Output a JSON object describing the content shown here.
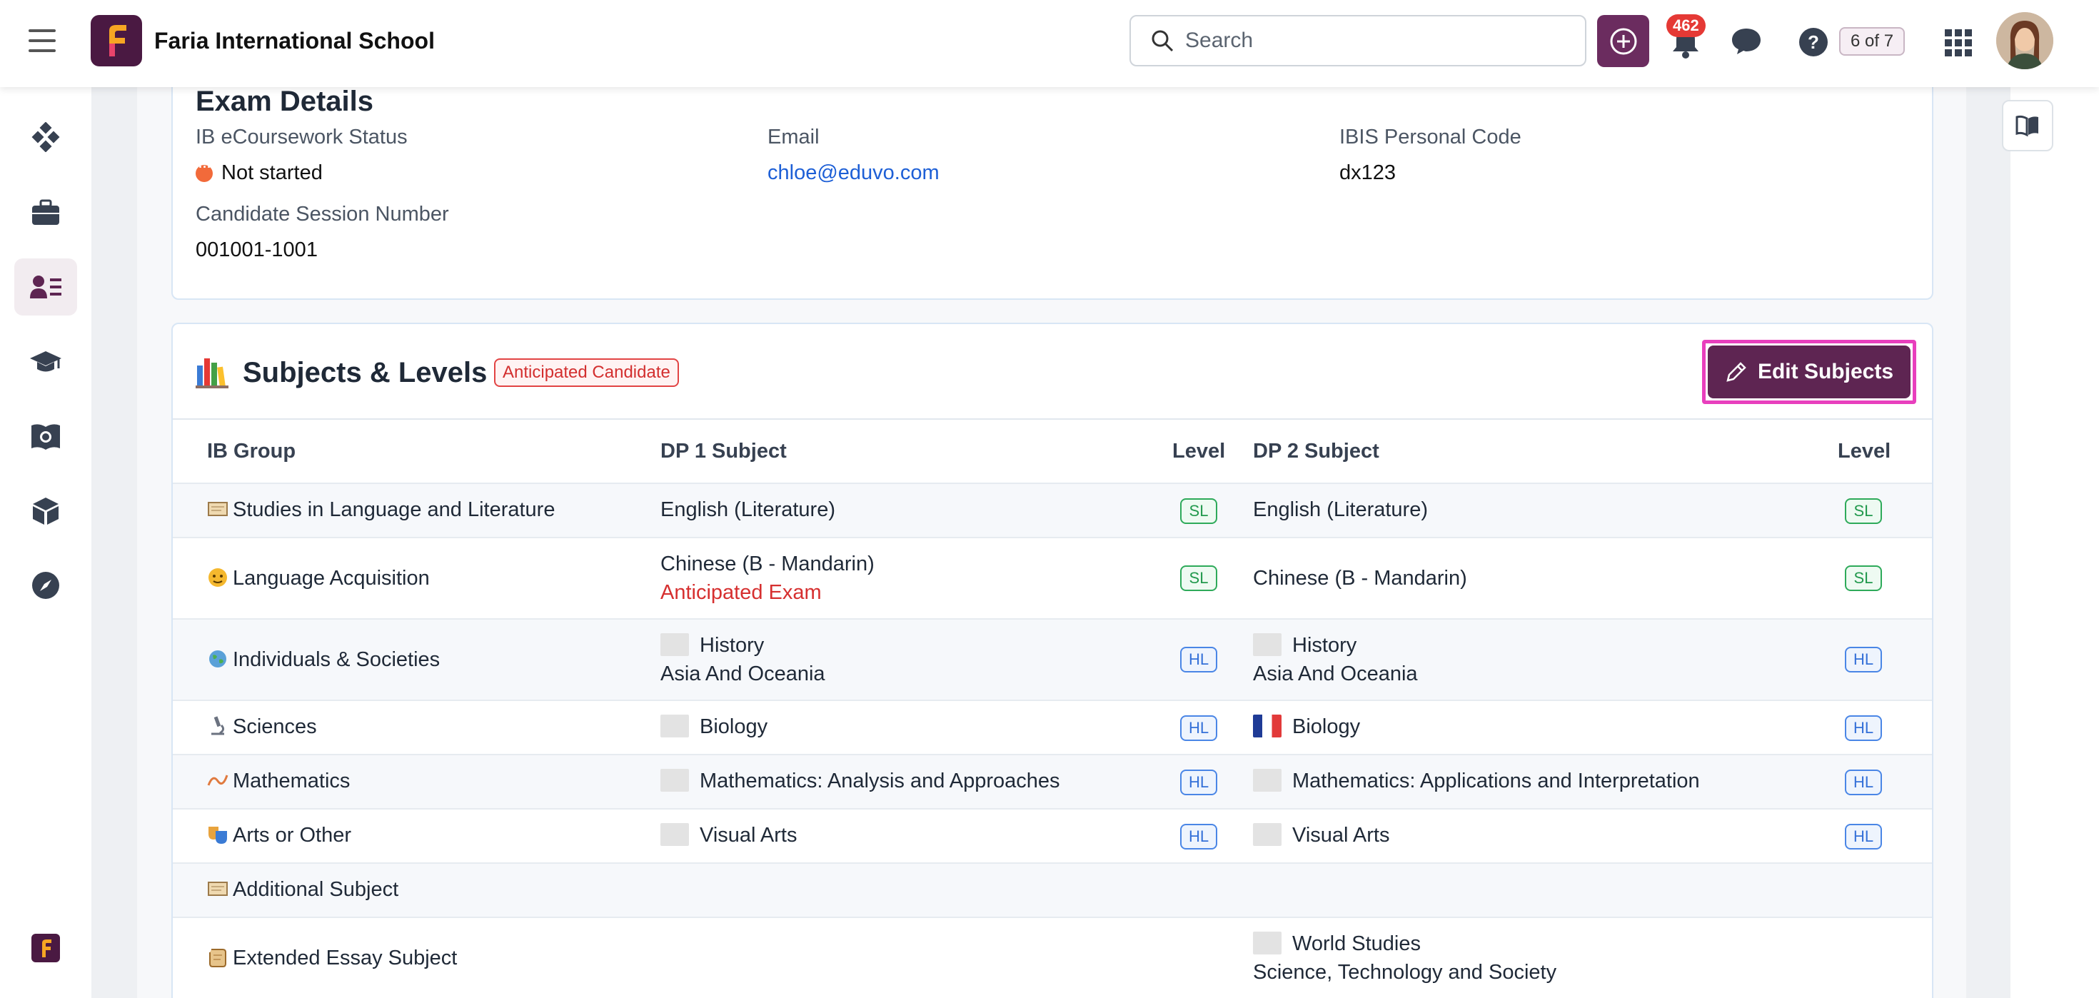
{
  "header": {
    "school_name": "Faria International School",
    "search_placeholder": "Search",
    "notification_count": "462",
    "progress": "6 of 7"
  },
  "sidebar": {
    "items": [
      {
        "name": "dashboard",
        "icon": "diamond-grid-icon"
      },
      {
        "name": "briefcase",
        "icon": "briefcase-icon"
      },
      {
        "name": "students",
        "icon": "student-list-icon",
        "active": true
      },
      {
        "name": "academics",
        "icon": "graduation-cap-icon"
      },
      {
        "name": "curriculum",
        "icon": "book-globe-icon"
      },
      {
        "name": "resources",
        "icon": "cube-icon"
      },
      {
        "name": "explore",
        "icon": "compass-icon"
      }
    ]
  },
  "exam": {
    "title": "Exam Details",
    "ecoursework_label": "IB eCoursework Status",
    "ecoursework_value": "Not started",
    "email_label": "Email",
    "email_value": "chloe@eduvo.com",
    "ibis_label": "IBIS Personal Code",
    "ibis_value": "dx123",
    "session_label": "Candidate Session Number",
    "session_value": "001001-1001"
  },
  "subjects": {
    "title": "Subjects & Levels",
    "badge": "Anticipated Candidate",
    "edit_button": "Edit Subjects",
    "columns": {
      "group": "IB Group",
      "dp1": "DP 1 Subject",
      "level1": "Level",
      "dp2": "DP 2 Subject",
      "level2": "Level"
    },
    "rows": [
      {
        "group": "Studies in Language and Literature",
        "dp1": "English (Literature)",
        "dp1_sub": "",
        "level1": "SL",
        "dp2": "English (Literature)",
        "dp2_sub": "",
        "level2": "SL"
      },
      {
        "group": "Language Acquisition",
        "dp1": "Chinese (B - Mandarin)",
        "dp1_sub": "Anticipated Exam",
        "level1": "SL",
        "dp2": "Chinese (B - Mandarin)",
        "dp2_sub": "",
        "level2": "SL"
      },
      {
        "group": "Individuals & Societies",
        "dp1": "History",
        "dp1_sub": "Asia And Oceania",
        "level1": "HL",
        "dp2": "History",
        "dp2_sub": "Asia And Oceania",
        "level2": "HL"
      },
      {
        "group": "Sciences",
        "dp1": "Biology",
        "dp1_sub": "",
        "level1": "HL",
        "dp2": "Biology",
        "dp2_sub": "",
        "level2": "HL"
      },
      {
        "group": "Mathematics",
        "dp1": "Mathematics: Analysis and Approaches",
        "dp1_sub": "",
        "level1": "HL",
        "dp2": "Mathematics: Applications and Interpretation",
        "dp2_sub": "",
        "level2": "HL"
      },
      {
        "group": "Arts or Other",
        "dp1": "Visual Arts",
        "dp1_sub": "",
        "level1": "HL",
        "dp2": "Visual Arts",
        "dp2_sub": "",
        "level2": "HL"
      },
      {
        "group": "Additional Subject",
        "dp1": "",
        "dp1_sub": "",
        "level1": "",
        "dp2": "",
        "dp2_sub": "",
        "level2": ""
      },
      {
        "group": "Extended Essay Subject",
        "dp1": "",
        "dp1_sub": "",
        "level1": "",
        "dp2": "World Studies",
        "dp2_sub": "Science, Technology and Society",
        "level2": ""
      }
    ]
  },
  "colors": {
    "brand": "#5e2552",
    "link": "#1d5fd6",
    "sl": "#2eaa5a",
    "hl": "#4a86e6",
    "alert": "#d32f2f"
  }
}
